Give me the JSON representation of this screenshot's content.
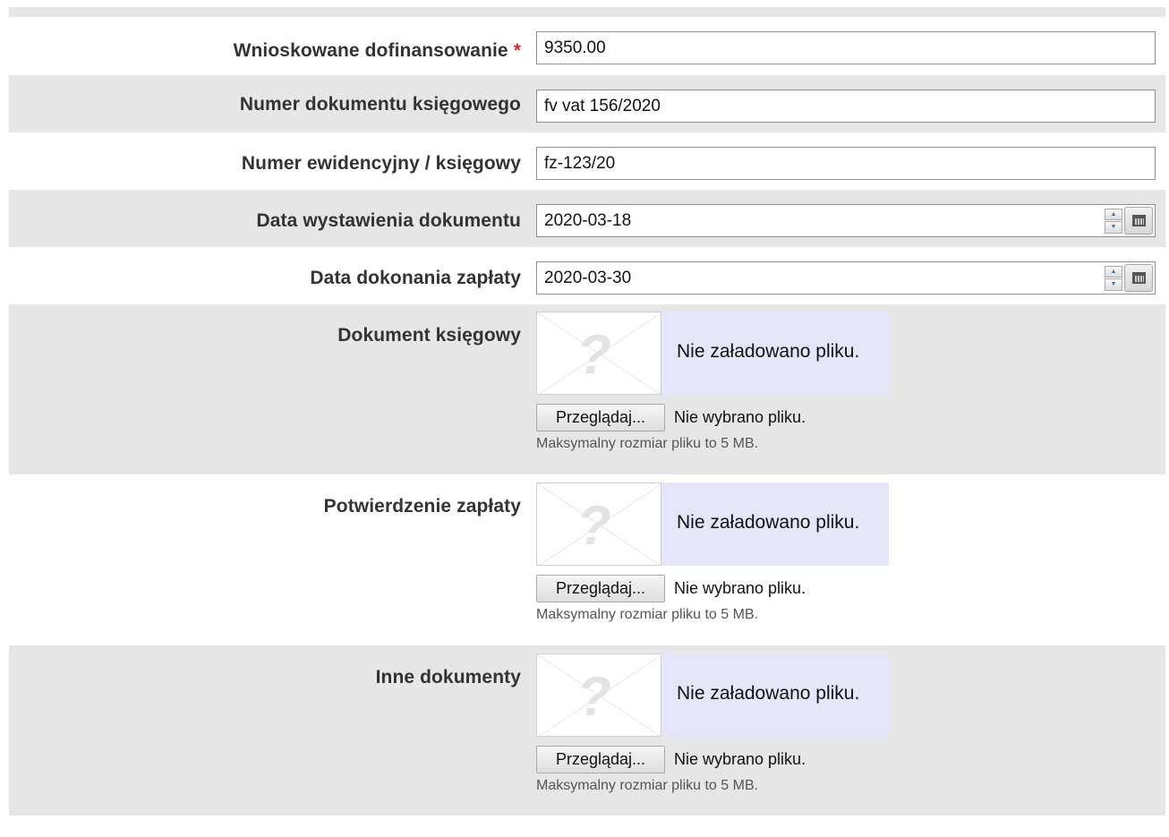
{
  "form": {
    "funding": {
      "label": "Wnioskowane dofinansowanie",
      "required_mark": "*",
      "value": "9350.00"
    },
    "doc_number": {
      "label": "Numer dokumentu księgowego",
      "value": "fv vat 156/2020"
    },
    "record_number": {
      "label": "Numer ewidencyjny / księgowy",
      "value": "fz-123/20"
    },
    "issue_date": {
      "label": "Data wystawienia dokumentu",
      "value": "2020-03-18"
    },
    "payment_date": {
      "label": "Data dokonania zapłaty",
      "value": "2020-03-30"
    },
    "uploads": [
      {
        "label": "Dokument księgowy",
        "status": "Nie załadowano pliku.",
        "browse": "Przeglądaj...",
        "chosen": "Nie wybrano pliku.",
        "max": "Maksymalny rozmiar pliku to 5 MB."
      },
      {
        "label": "Potwierdzenie zapłaty",
        "status": "Nie załadowano pliku.",
        "browse": "Przeglądaj...",
        "chosen": "Nie wybrano pliku.",
        "max": "Maksymalny rozmiar pliku to 5 MB."
      },
      {
        "label": "Inne dokumenty",
        "status": "Nie załadowano pliku.",
        "browse": "Przeglądaj...",
        "chosen": "Nie wybrano pliku.",
        "max": "Maksymalny rozmiar pliku to 5 MB."
      }
    ]
  },
  "icons": {
    "placeholder": "question-mark-placeholder-icon",
    "calendar": "calendar-icon",
    "spinner": "spinner-icon"
  },
  "colors": {
    "required": "#d9262c",
    "row_shade": "#e6e6e6",
    "preview_bg": "#e6e6fa"
  }
}
